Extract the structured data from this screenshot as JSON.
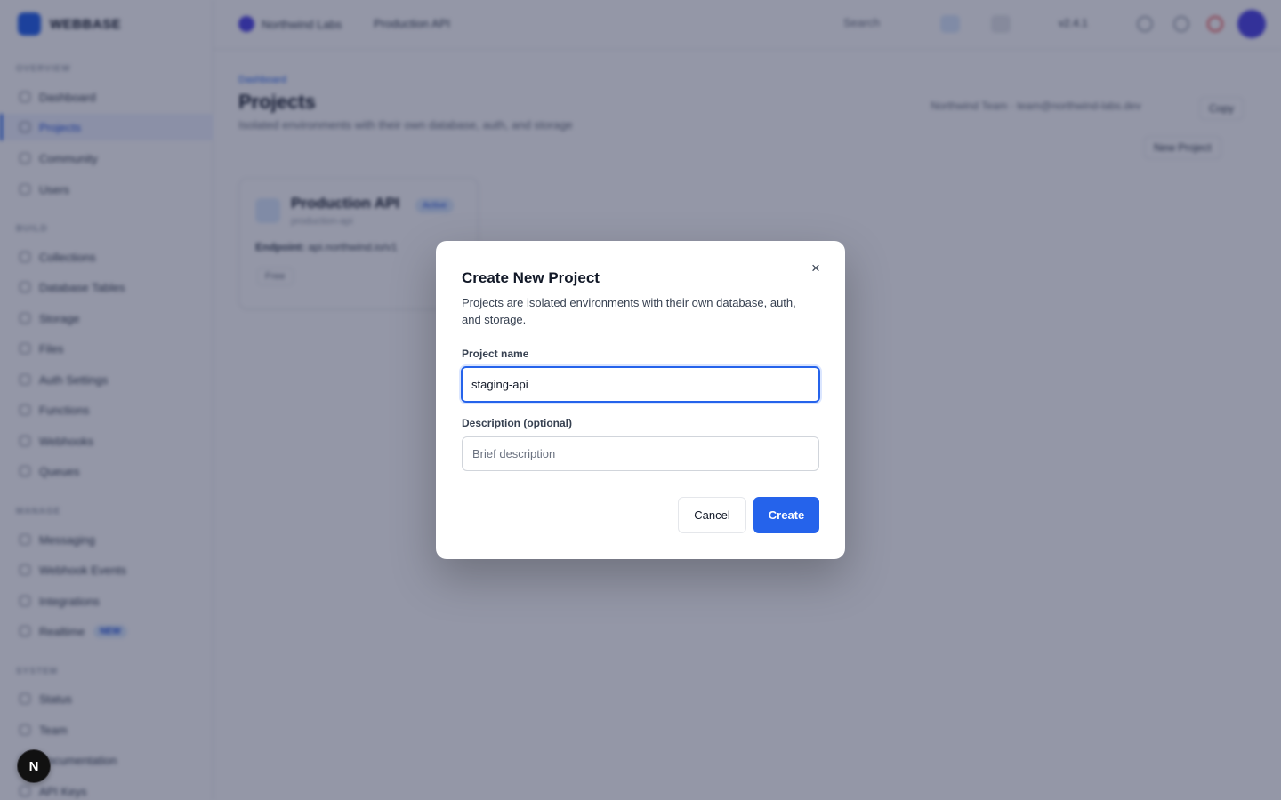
{
  "app": {
    "brand_name": "WEBBASE",
    "topbar": {
      "org_name": "Northwind Labs",
      "project_name": "Production API",
      "search_label": "Search",
      "env_label": "v2.4.1"
    },
    "sidebar": {
      "sections": [
        {
          "title": "OVERVIEW",
          "items": [
            {
              "label": "Dashboard"
            },
            {
              "label": "Projects",
              "active": true
            },
            {
              "label": "Community"
            },
            {
              "label": "Users"
            }
          ]
        },
        {
          "title": "BUILD",
          "items": [
            {
              "label": "Collections"
            },
            {
              "label": "Database Tables"
            },
            {
              "label": "Storage"
            },
            {
              "label": "Files"
            },
            {
              "label": "Auth Settings"
            },
            {
              "label": "Functions"
            },
            {
              "label": "Webhooks"
            },
            {
              "label": "Queues"
            }
          ]
        },
        {
          "title": "MANAGE",
          "items": [
            {
              "label": "Messaging"
            },
            {
              "label": "Webhook Events"
            },
            {
              "label": "Integrations"
            },
            {
              "label": "Realtime",
              "badge": "NEW"
            }
          ]
        },
        {
          "title": "SYSTEM",
          "items": [
            {
              "label": "Status"
            },
            {
              "label": "Team"
            },
            {
              "label": "Documentation"
            },
            {
              "label": "API Keys"
            }
          ]
        }
      ]
    },
    "main": {
      "breadcrumb": "Dashboard",
      "title": "Projects",
      "subtitle": "Isolated environments with their own database, auth, and storage",
      "meta": "Northwind Team  ·  team@northwind-labs.dev",
      "meta_button": "Copy",
      "new_button": "New Project",
      "card": {
        "name": "Production API",
        "id": "production-api",
        "badge": "Active",
        "endpoint_label": "Endpoint:",
        "endpoint": "api.northwind.io/v1",
        "chip": "Free"
      }
    }
  },
  "dialog": {
    "title": "Create New Project",
    "description": "Projects are isolated environments with their own database, auth, and storage.",
    "name_label": "Project name",
    "name_value": "staging-api",
    "description_label": "Description (optional)",
    "description_placeholder": "Brief description",
    "cancel_label": "Cancel",
    "create_label": "Create",
    "close_icon": "close-icon"
  },
  "dev_badge": "N",
  "colors": {
    "accent": "#2563eb",
    "overlay": "#11183b"
  }
}
